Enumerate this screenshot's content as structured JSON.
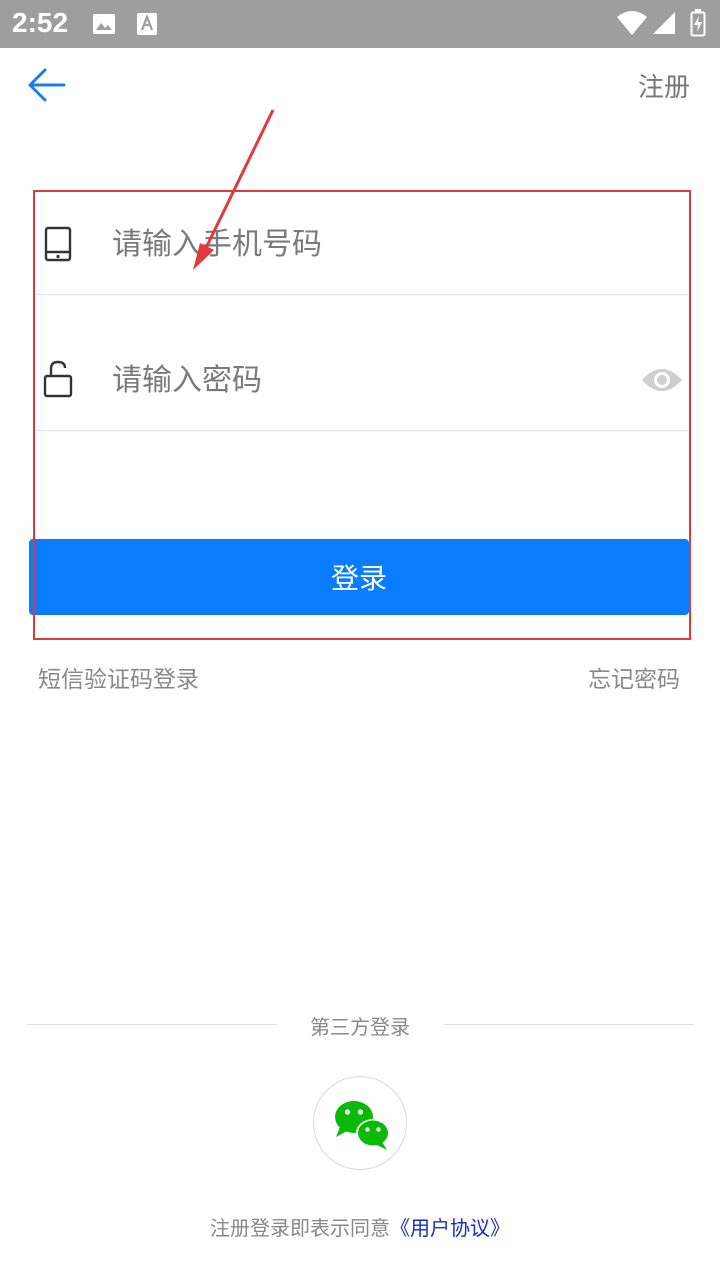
{
  "status_bar": {
    "time": "2:52"
  },
  "header": {
    "register_label": "注册"
  },
  "form": {
    "phone_placeholder": "请输入手机号码",
    "password_placeholder": "请输入密码",
    "login_label": "登录"
  },
  "links": {
    "sms_login": "短信验证码登录",
    "forgot_password": "忘记密码"
  },
  "third_party": {
    "title": "第三方登录"
  },
  "agreement": {
    "prefix": "注册登录即表示同意",
    "link": "《用户协议》"
  },
  "colors": {
    "accent": "#0a7cff",
    "highlight": "#e0393e",
    "wechat": "#09bb07",
    "status_bar": "#9e9e9e"
  }
}
